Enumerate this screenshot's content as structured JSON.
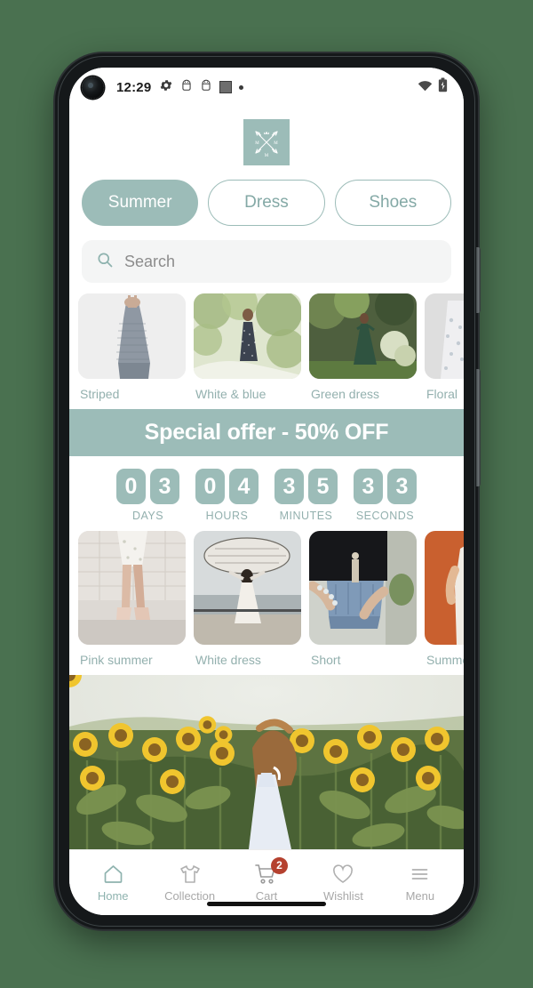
{
  "device": {
    "status_bar": {
      "time": "12:29",
      "left_icons": [
        "gear-icon",
        "android-robot-icon",
        "android-robot-icon",
        "square-icon",
        "dot-icon"
      ],
      "right_icons": [
        "wifi-icon",
        "battery-charging-icon"
      ]
    },
    "side_buttons": [
      "volume-rocker",
      "power-button"
    ],
    "home_indicator": true
  },
  "app": {
    "logo": {
      "name": "crossed-arrows-crown-logo",
      "letters": [
        "M",
        "M",
        "M"
      ],
      "background": "#9cbcb8"
    },
    "categories": [
      {
        "label": "Summer",
        "active": true
      },
      {
        "label": "Dress",
        "active": false
      },
      {
        "label": "Shoes",
        "active": false
      }
    ],
    "search": {
      "placeholder": "Search",
      "value": "",
      "icon": "search-icon"
    },
    "product_row_1": [
      {
        "label": "Striped",
        "image": "woman-in-striped-dress-back-view"
      },
      {
        "label": "White & blue",
        "image": "woman-white-blue-dress-garden"
      },
      {
        "label": "Green dress",
        "image": "woman-green-dress-garden"
      },
      {
        "label": "Floral",
        "image": "floral-dress-partial"
      }
    ],
    "offer": {
      "banner_text": "Special offer - 50% OFF",
      "banner_color": "#9cbcb8"
    },
    "countdown": [
      {
        "value": "03",
        "label": "DAYS"
      },
      {
        "value": "04",
        "label": "HOURS"
      },
      {
        "value": "35",
        "label": "MINUTES"
      },
      {
        "value": "33",
        "label": "SECONDS"
      }
    ],
    "product_row_2": [
      {
        "label": "Pink summer",
        "image": "pink-heels-on-pavement"
      },
      {
        "label": "White dress",
        "image": "woman-white-dress-holding-blanket-sea"
      },
      {
        "label": "Short",
        "image": "denim-shorts-closeup"
      },
      {
        "label": "Summer",
        "image": "woman-orange-background-partial"
      }
    ],
    "hero": {
      "image": "woman-white-dress-in-sunflower-field",
      "alt": "Woman walking through a sunflower field"
    },
    "bottom_nav": [
      {
        "label": "Home",
        "icon": "home-icon",
        "active": true,
        "badge": null
      },
      {
        "label": "Collection",
        "icon": "tshirt-icon",
        "active": false,
        "badge": null
      },
      {
        "label": "Cart",
        "icon": "cart-icon",
        "active": false,
        "badge": "2"
      },
      {
        "label": "Wishlist",
        "icon": "heart-icon",
        "active": false,
        "badge": null
      },
      {
        "label": "Menu",
        "icon": "hamburger-icon",
        "active": false,
        "badge": null
      }
    ]
  },
  "colors": {
    "accent": "#9cbcb8",
    "accent_text": "#93b0ae",
    "badge": "#b5412f",
    "page_background": "#4a7150"
  }
}
